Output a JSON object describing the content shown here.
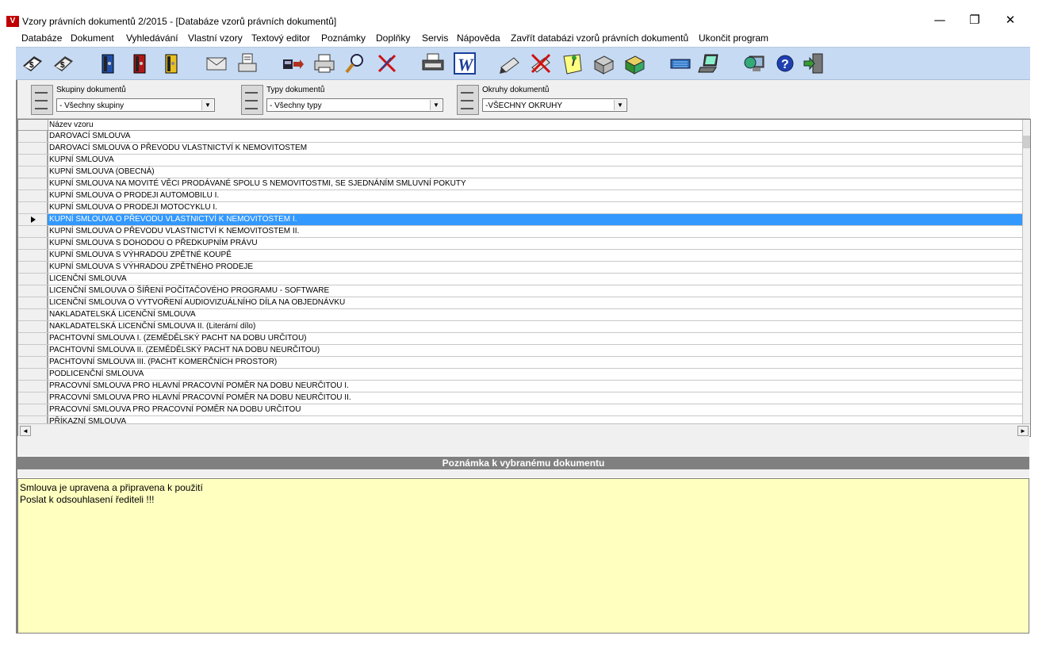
{
  "window": {
    "title": "Vzory právních dokumentů 2/2015 - [Databáze vzorů právních dokumentů]",
    "app_icon_text": "V",
    "minimize_glyph": "—",
    "restore_glyph": "❐",
    "close_glyph": "✕"
  },
  "menu": [
    "Databáze",
    "Dokument",
    "Vyhledávání",
    "Vlastní vzory",
    "Textový editor",
    "Poznámky",
    "Doplňky",
    "Servis",
    "Nápověda",
    "Zavřít databázi vzorů právních dokumentů",
    "Ukončit program"
  ],
  "toolbar": {
    "icons": [
      "book-dollar-icon",
      "book-dollar-alt-icon",
      "blue-binder-icon",
      "red-binder-icon",
      "yellow-binder-icon",
      "envelope-icon",
      "printer-document-icon",
      "export-icon",
      "printer-icon",
      "magnifier-icon",
      "cross-pencils-icon",
      "typewriter-icon",
      "word-icon",
      "pen-icon",
      "pen-cross-icon",
      "note-pin-icon",
      "cabinet-icon",
      "box-arrow-icon",
      "keyboard-icon",
      "laptop-icon",
      "globe-monitor-icon",
      "help-icon",
      "exit-door-icon"
    ],
    "word_glyph": "W",
    "help_glyph": "?"
  },
  "filters": {
    "groups": {
      "label": "Skupiny dokumentů",
      "value": "- Všechny skupiny"
    },
    "types": {
      "label": "Typy dokumentů",
      "value": "- Všechny typy"
    },
    "areas": {
      "label": "Okruhy dokumentů",
      "value": "-VŠECHNY OKRUHY"
    },
    "dropdown_glyph": "▼"
  },
  "grid": {
    "column_header": "Název vzoru",
    "selected_index": 7,
    "rows": [
      "DAROVACÍ SMLOUVA",
      "DAROVACÍ SMLOUVA O PŘEVODU VLASTNICTVÍ K NEMOVITOSTEM",
      "KUPNÍ SMLOUVA",
      "KUPNÍ SMLOUVA (OBECNÁ)",
      "KUPNÍ SMLOUVA NA MOVITÉ VĚCI PRODÁVANÉ SPOLU S NEMOVITOSTMI, SE SJEDNÁNÍM SMLUVNÍ POKUTY",
      "KUPNÍ SMLOUVA O PRODEJI AUTOMOBILU I.",
      "KUPNÍ SMLOUVA O PRODEJI MOTOCYKLU I.",
      "KUPNÍ SMLOUVA O PŘEVODU VLASTNICTVÍ K NEMOVITOSTEM I.",
      "KUPNÍ SMLOUVA O PŘEVODU VLASTNICTVÍ K NEMOVITOSTEM II.",
      "KUPNÍ SMLOUVA S DOHODOU O PŘEDKUPNÍM PRÁVU",
      "KUPNÍ SMLOUVA S VÝHRADOU ZPĚTNÉ KOUPĚ",
      "KUPNÍ SMLOUVA S VÝHRADOU ZPĚTNÉHO PRODEJE",
      "LICENČNÍ SMLOUVA",
      "LICENČNÍ SMLOUVA O ŠÍŘENÍ POČÍTAČOVÉHO PROGRAMU - SOFTWARE",
      "LICENČNÍ SMLOUVA O VYTVOŘENÍ AUDIOVIZUÁLNÍHO DÍLA NA OBJEDNÁVKU",
      "NAKLADATELSKÁ LICENČNÍ SMLOUVA",
      "NAKLADATELSKÁ LICENČNÍ SMLOUVA II. (Literární dílo)",
      "PACHTOVNÍ SMLOUVA I. (ZEMĚDĚLSKÝ PACHT NA DOBU URČITOU)",
      "PACHTOVNÍ SMLOUVA II. (ZEMĚDĚLSKÝ PACHT NA DOBU NEURČITOU)",
      "PACHTOVNÍ SMLOUVA III. (PACHT KOMERČNÍCH PROSTOR)",
      "PODLICENČNÍ SMLOUVA",
      "PRACOVNÍ SMLOUVA PRO HLAVNÍ PRACOVNÍ POMĚR NA DOBU NEURČITOU I.",
      "PRACOVNÍ SMLOUVA PRO HLAVNÍ PRACOVNÍ POMĚR NA DOBU NEURČITOU II.",
      "PRACOVNÍ SMLOUVA PRO PRACOVNÍ POMĚR NA DOBU URČITOU",
      "PŘÍKAZNÍ SMLOUVA"
    ],
    "scroll_left_glyph": "◄",
    "scroll_right_glyph": "►"
  },
  "note": {
    "header": "Poznámka k vybranému dokumentu",
    "lines": [
      "Smlouva je upravena a připravena k použití",
      "Poslat k odsouhlasení řediteli !!!"
    ]
  },
  "colors": {
    "selection": "#3399ff",
    "toolbar_bg": "#c6daf3",
    "note_bg": "#ffffc0",
    "note_header_bg": "#808080"
  }
}
